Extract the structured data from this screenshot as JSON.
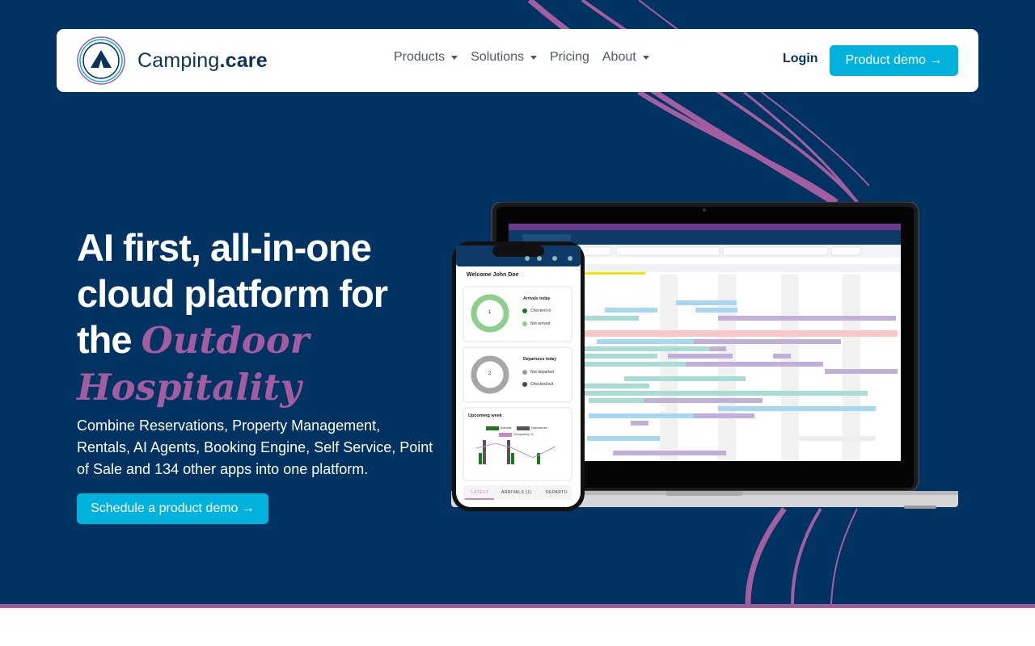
{
  "brand": {
    "name_part1": "Camping",
    "name_part2": ".care"
  },
  "nav": {
    "items": [
      {
        "label": "Products",
        "dropdown": true
      },
      {
        "label": "Solutions",
        "dropdown": true
      },
      {
        "label": "Pricing",
        "dropdown": false
      },
      {
        "label": "About",
        "dropdown": true
      }
    ],
    "login": "Login",
    "demo_button": "Product demo →"
  },
  "hero": {
    "headline_plain": "AI first, all-in-one cloud platform for the ",
    "headline_accent": "Outdoor Hospitality",
    "subtext": "Combine Reservations, Property Management, Rentals, AI Agents, Booking Engine, Self Service, Point of Sale and 134 other apps into one platform.",
    "cta_button": "Schedule a product demo →"
  },
  "phone_app": {
    "welcome": "Welcome John Doe",
    "arrivals": {
      "title": "Arrivals today",
      "count": "1",
      "legend": [
        "Checked-in",
        "Not arrived"
      ]
    },
    "departures": {
      "title": "Departures today",
      "count": "2",
      "legend": [
        "Not departed",
        "Checked-out"
      ]
    },
    "upcoming": {
      "title": "Upcoming week",
      "legend": [
        "Arrivals",
        "Departures",
        "Occupancy %"
      ]
    },
    "tabs": [
      "LATEST",
      "ARRIVALS (1)",
      "DEPARTU"
    ]
  },
  "colors": {
    "hero_bg": "#003362",
    "accent_purple": "#a45ca1",
    "button_cyan": "#00b2dc",
    "brand_navy": "#0b3357"
  }
}
